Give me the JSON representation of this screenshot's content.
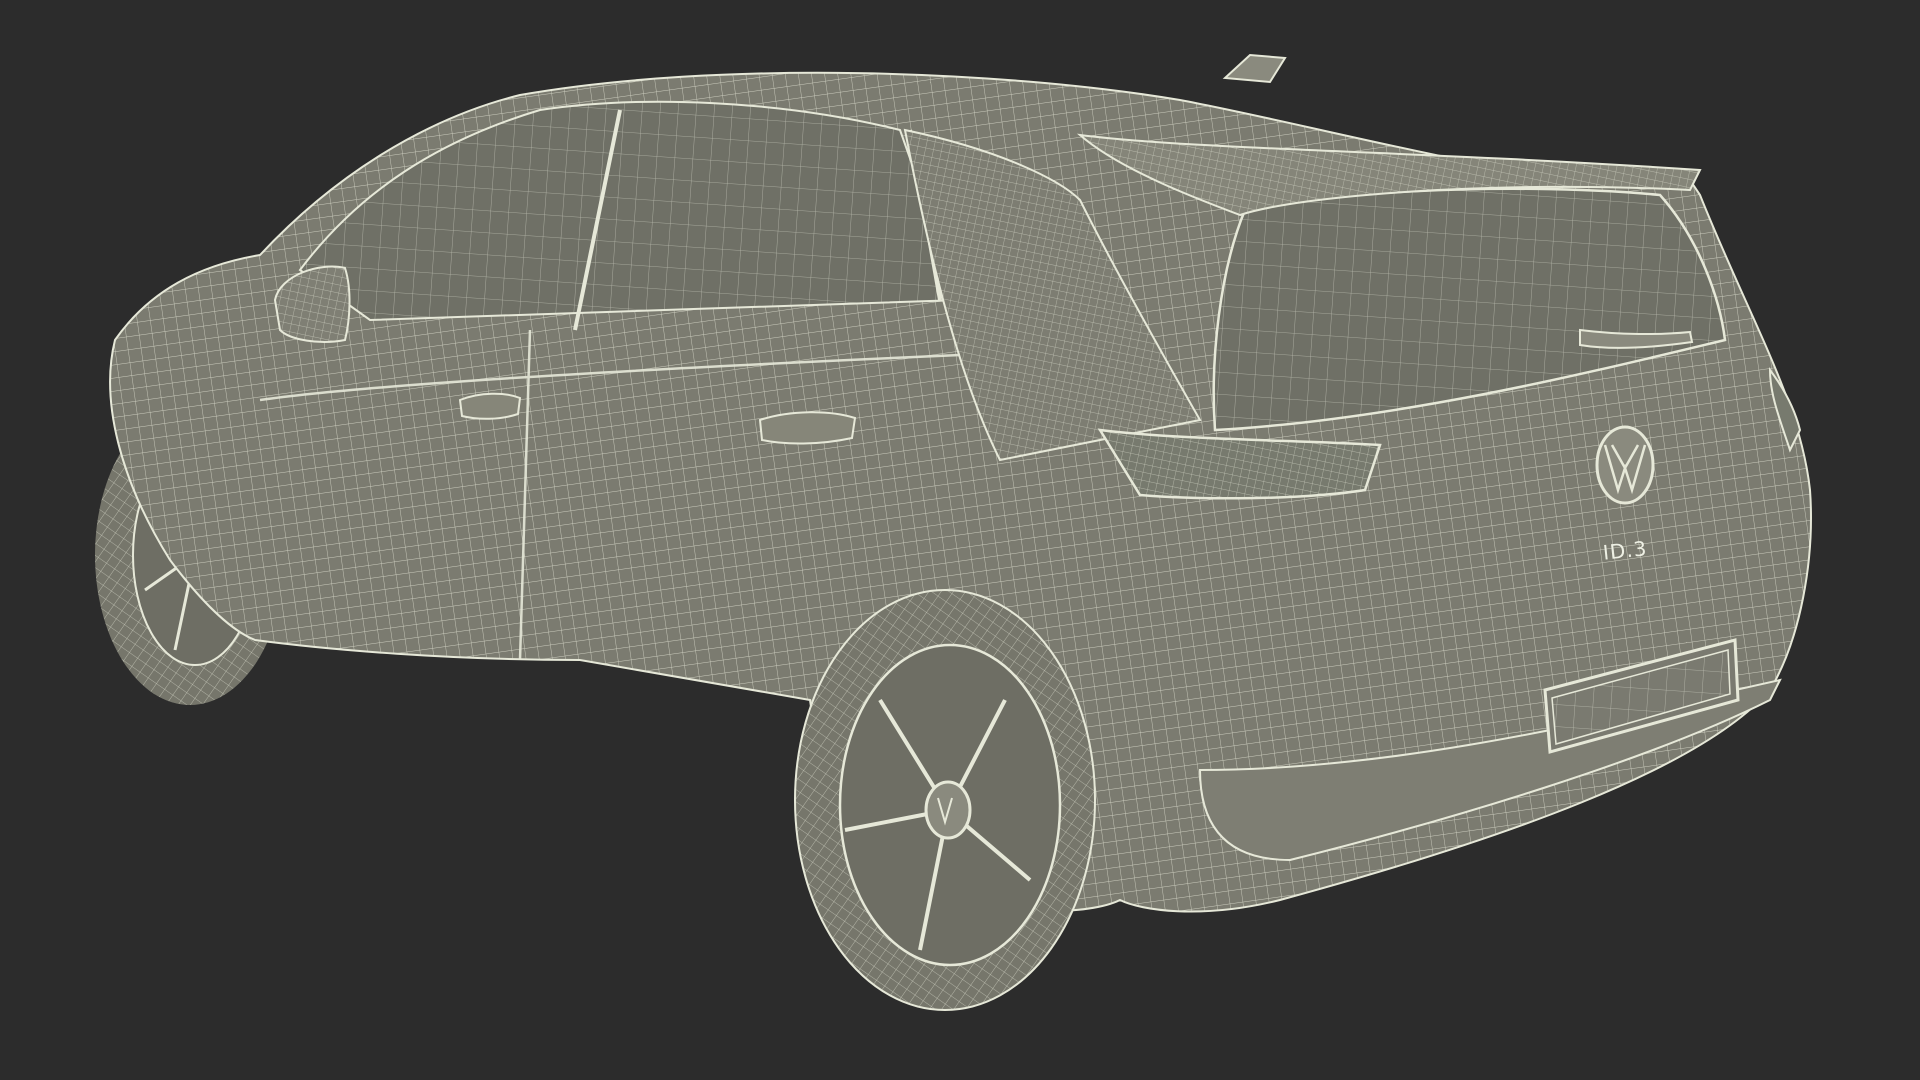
{
  "scene": {
    "subject": "wireframe-car",
    "background_color": "#2c2c2c",
    "body_color": "#7b7b70",
    "wire_color": "#e6e8d8",
    "glass_color": "#6f7066",
    "badge_text": "ID.3"
  }
}
